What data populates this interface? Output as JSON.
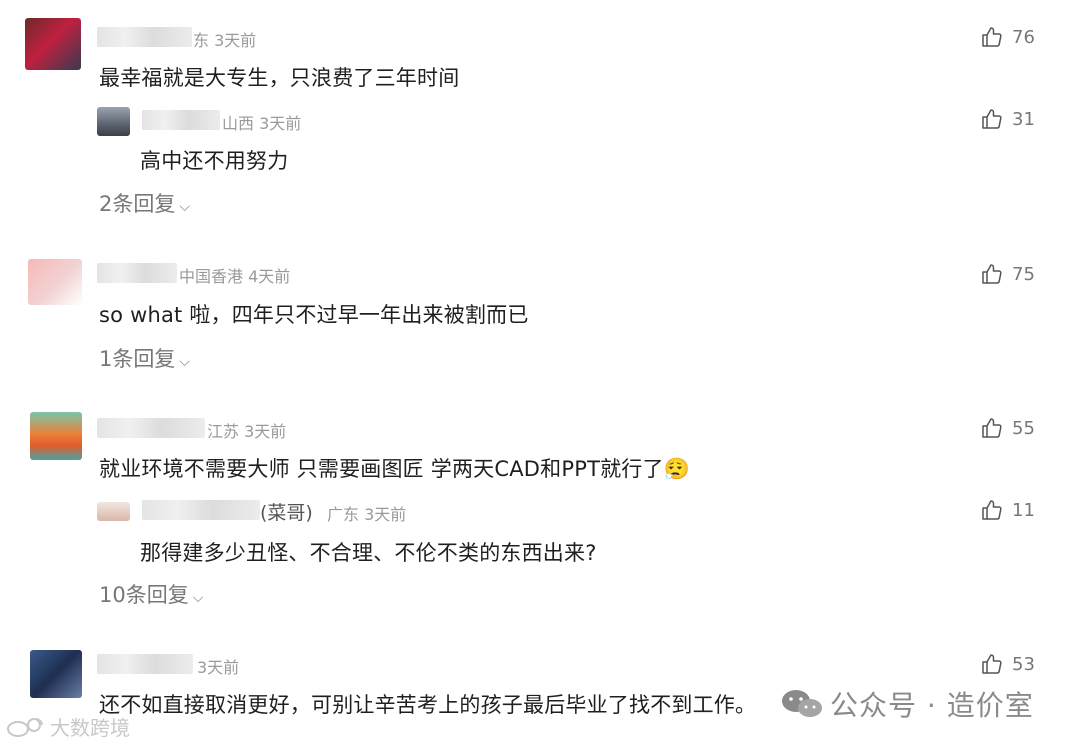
{
  "comments": [
    {
      "meta": "东 3天前",
      "text": "最幸福就是大专生，只浪费了三年时间",
      "likes": "76",
      "reply": {
        "meta": "山西 3天前",
        "text": "高中还不用努力",
        "likes": "31"
      },
      "replies_label": "2条回复"
    },
    {
      "meta": "中国香港 4天前",
      "text": "so what 啦，四年只不过早一年出来被割而已",
      "likes": "75",
      "replies_label": "1条回复"
    },
    {
      "meta": "江苏 3天前",
      "text": "就业环境不需要大师 只需要画图匠 学两天CAD和PPT就行了😮‍💨",
      "likes": "55",
      "reply": {
        "name_tail": "(菜哥)",
        "meta": "广东 3天前",
        "text": "那得建多少丑怪、不合理、不伦不类的东西出来?",
        "likes": "11"
      },
      "replies_label": "10条回复"
    },
    {
      "meta": "3天前",
      "text": "还不如直接取消更好，可别让辛苦考上的孩子最后毕业了找不到工作。",
      "likes": "53"
    }
  ],
  "watermarks": {
    "left": "大数跨境",
    "right": "公众号 · 造价室"
  },
  "colors": {
    "meta": "#9a9a9a",
    "text": "#1f1f1f",
    "muted": "#777777"
  },
  "icons": {
    "like": "thumbs-up-icon",
    "chevron": "chevron-down-icon",
    "wechat": "wechat-icon",
    "weibo": "weibo-icon"
  }
}
